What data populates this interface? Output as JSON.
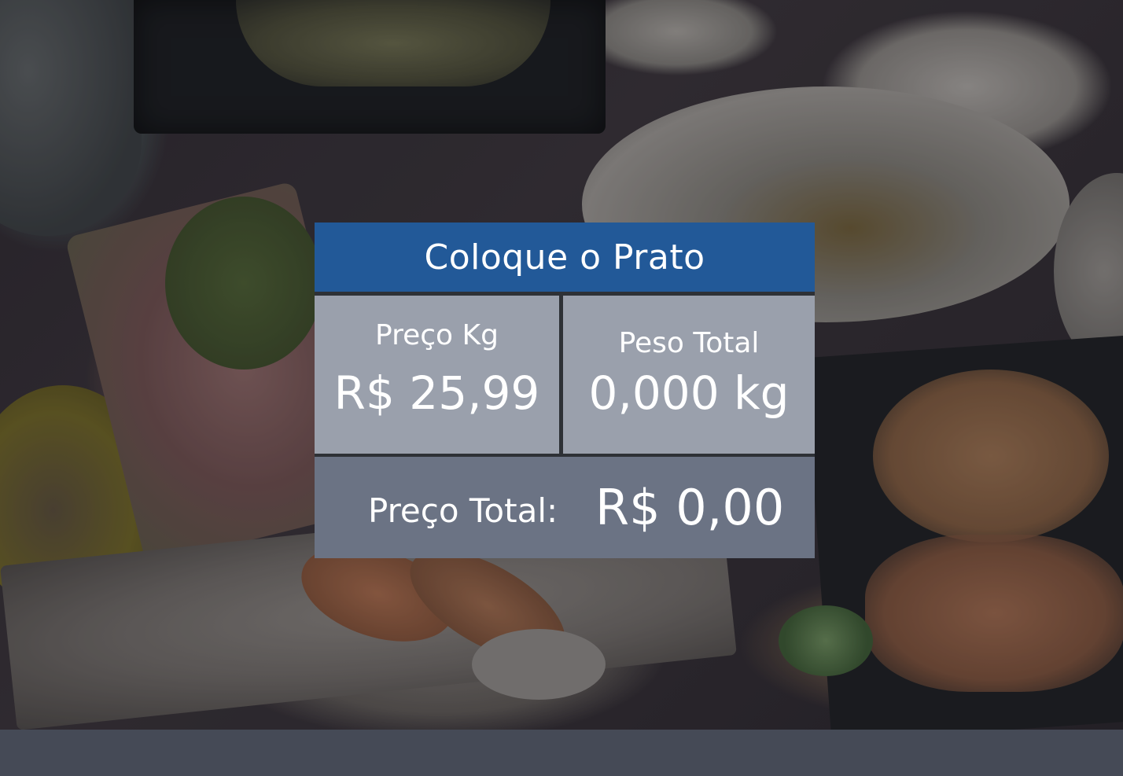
{
  "panel": {
    "title": "Coloque o Prato",
    "price_per_kg": {
      "label": "Preço Kg",
      "value": "R$ 25,99"
    },
    "total_weight": {
      "label": "Peso Total",
      "value": "0,000 kg"
    },
    "total_price": {
      "label": "Preço Total:",
      "value": "R$ 0,00"
    }
  },
  "colors": {
    "header": "#225998",
    "cell_background": "#9aa0ac",
    "total_background": "#6b7384",
    "separator": "#2e3136",
    "footer_bar": "#454a56",
    "text": "#ffffff"
  },
  "background": {
    "image": "japanese-food-table-photo"
  }
}
